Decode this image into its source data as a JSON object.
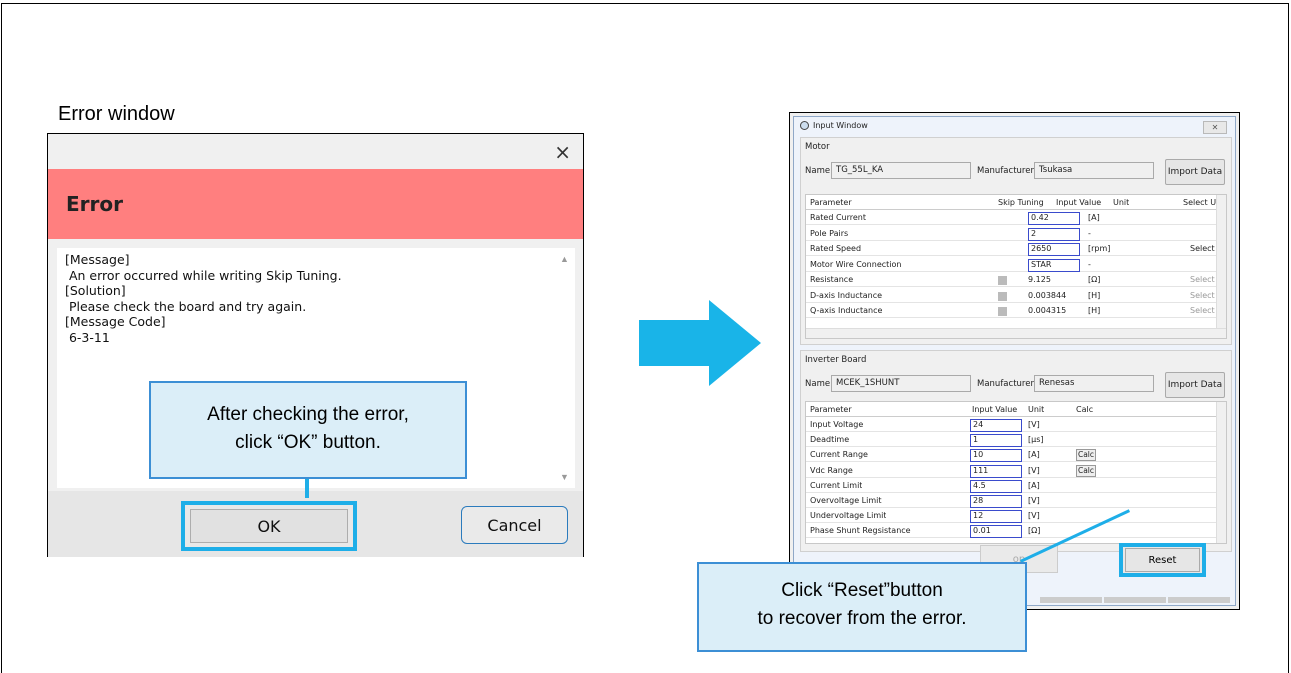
{
  "caption": "Error window",
  "error_dialog": {
    "close_glyph": "×",
    "header_title": "Error",
    "message_lines": [
      "[Message]",
      " An error occurred while writing Skip Tuning.",
      "[Solution]",
      " Please check the board and try again.",
      "[Message Code]",
      " 6-3-11"
    ],
    "ok_label": "OK",
    "cancel_label": "Cancel",
    "scroll_up": "▲",
    "scroll_down": "▼"
  },
  "callout_ok": {
    "line1": "After checking the error,",
    "line2": "click  “OK”  button."
  },
  "arrow_color": "#19b4e8",
  "input_window": {
    "title": "Input Window",
    "close_glyph": "✕",
    "motor": {
      "group_label": "Motor",
      "name_label": "Name",
      "name_value": "TG_55L_KA",
      "manufacturer_label": "Manufacturer",
      "manufacturer_value": "Tsukasa",
      "import_label": "Import Data",
      "headers": [
        "Parameter",
        "Skip Tuning",
        "Input Value",
        "Unit",
        "Select U"
      ],
      "rows": [
        {
          "param": "Rated Current",
          "value": "0.42",
          "unit": "[A]",
          "select": ""
        },
        {
          "param": "Pole Pairs",
          "value": "2",
          "unit": "-",
          "select": ""
        },
        {
          "param": "Rated Speed",
          "value": "2650",
          "unit": "[rpm]",
          "select": "Select"
        },
        {
          "param": "Motor Wire Connection",
          "value": "STAR",
          "unit": "-",
          "select": ""
        },
        {
          "param": "Resistance",
          "value": "9.125",
          "unit": "[Ω]",
          "select": "Select"
        },
        {
          "param": "D-axis Inductance",
          "value": "0.003844",
          "unit": "[H]",
          "select": "Select"
        },
        {
          "param": "Q-axis Inductance",
          "value": "0.004315",
          "unit": "[H]",
          "select": "Select"
        }
      ]
    },
    "inverter": {
      "group_label": "Inverter Board",
      "name_label": "Name",
      "name_value": "MCEK_1SHUNT",
      "manufacturer_label": "Manufacturer",
      "manufacturer_value": "Renesas",
      "import_label": "Import Data",
      "headers": [
        "Parameter",
        "Input Value",
        "Unit",
        "Calc"
      ],
      "rows": [
        {
          "param": "Input Voltage",
          "value": "24",
          "unit": "[V]",
          "calc": ""
        },
        {
          "param": "Deadtime",
          "value": "1",
          "unit": "[μs]",
          "calc": ""
        },
        {
          "param": "Current Range",
          "value": "10",
          "unit": "[A]",
          "calc": "Calc"
        },
        {
          "param": "Vdc Range",
          "value": "111",
          "unit": "[V]",
          "calc": "Calc"
        },
        {
          "param": "Current Limit",
          "value": "4.5",
          "unit": "[A]",
          "calc": ""
        },
        {
          "param": "Overvoltage Limit",
          "value": "28",
          "unit": "[V]",
          "calc": ""
        },
        {
          "param": "Undervoltage Limit",
          "value": "12",
          "unit": "[V]",
          "calc": ""
        },
        {
          "param": "Phase Shunt Regsistance",
          "value": "0.01",
          "unit": "[Ω]",
          "calc": ""
        }
      ]
    },
    "stop_label": "op",
    "reset_label": "Reset"
  },
  "callout_reset": {
    "line1": "Click  “Reset”button",
    "line2": "to recover from the error."
  }
}
